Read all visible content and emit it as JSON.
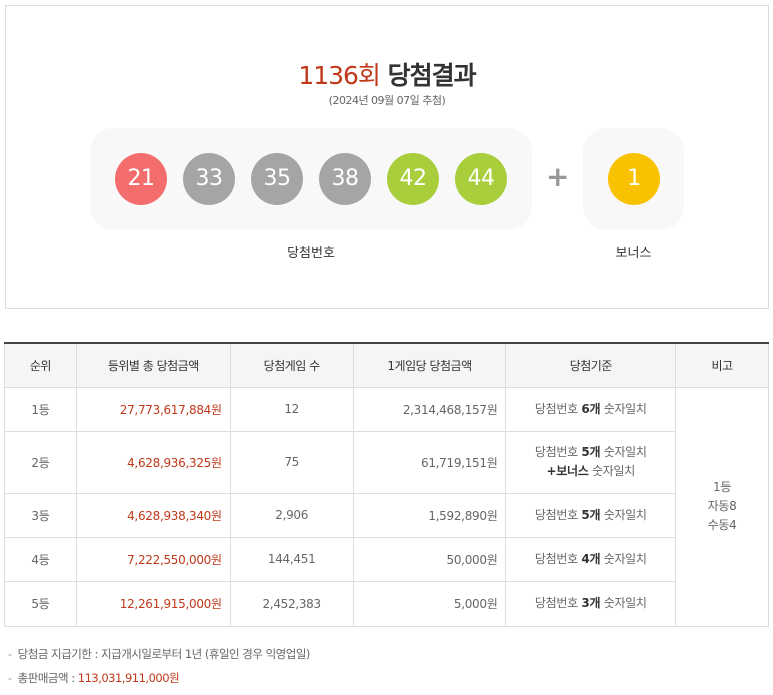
{
  "result": {
    "round": "1136회",
    "title_suffix": "당첨결과",
    "date": "(2024년 09월 07일 추첨)",
    "numbers": [
      {
        "value": "21",
        "color": "#f46d6d"
      },
      {
        "value": "33",
        "color": "#a5a5a5"
      },
      {
        "value": "35",
        "color": "#a5a5a5"
      },
      {
        "value": "38",
        "color": "#a5a5a5"
      },
      {
        "value": "42",
        "color": "#a8cf3b"
      },
      {
        "value": "44",
        "color": "#a8cf3b"
      }
    ],
    "plus": "+",
    "bonus": {
      "value": "1",
      "color": "#f8c200"
    },
    "label_numbers": "당첨번호",
    "label_bonus": "보너스"
  },
  "table": {
    "headers": [
      "순위",
      "등위별 총 당첨금액",
      "당첨게임 수",
      "1게임당 당첨금액",
      "당첨기준",
      "비고"
    ],
    "rows": [
      {
        "rank": "1등",
        "total": "27,773,617,884원",
        "count": "12",
        "per_game": "2,314,468,157원",
        "std_pre": "당첨번호 ",
        "std_bold": "6개",
        "std_post": " 숫자일치",
        "std2_bold": "",
        "std2_post": ""
      },
      {
        "rank": "2등",
        "total": "4,628,936,325원",
        "count": "75",
        "per_game": "61,719,151원",
        "std_pre": "당첨번호 ",
        "std_bold": "5개",
        "std_post": " 숫자일치",
        "std2_bold": "+보너스",
        "std2_post": " 숫자일치"
      },
      {
        "rank": "3등",
        "total": "4,628,938,340원",
        "count": "2,906",
        "per_game": "1,592,890원",
        "std_pre": "당첨번호 ",
        "std_bold": "5개",
        "std_post": " 숫자일치",
        "std2_bold": "",
        "std2_post": ""
      },
      {
        "rank": "4등",
        "total": "7,222,550,000원",
        "count": "144,451",
        "per_game": "50,000원",
        "std_pre": "당첨번호 ",
        "std_bold": "4개",
        "std_post": " 숫자일치",
        "std2_bold": "",
        "std2_post": ""
      },
      {
        "rank": "5등",
        "total": "12,261,915,000원",
        "count": "2,452,383",
        "per_game": "5,000원",
        "std_pre": "당첨번호 ",
        "std_bold": "3개",
        "std_post": " 숫자일치",
        "std2_bold": "",
        "std2_post": ""
      }
    ],
    "note_line1": "1등",
    "note_line2": "자동8",
    "note_line3": "수동4"
  },
  "notes": {
    "dash": "-",
    "deadline_label": "당첨금 지급기한 : 지급개시일로부터 1년 (휴일인 경우 익영업일)",
    "sales_label": "총판매금액 : ",
    "sales_value": "113,031,911,000원"
  }
}
